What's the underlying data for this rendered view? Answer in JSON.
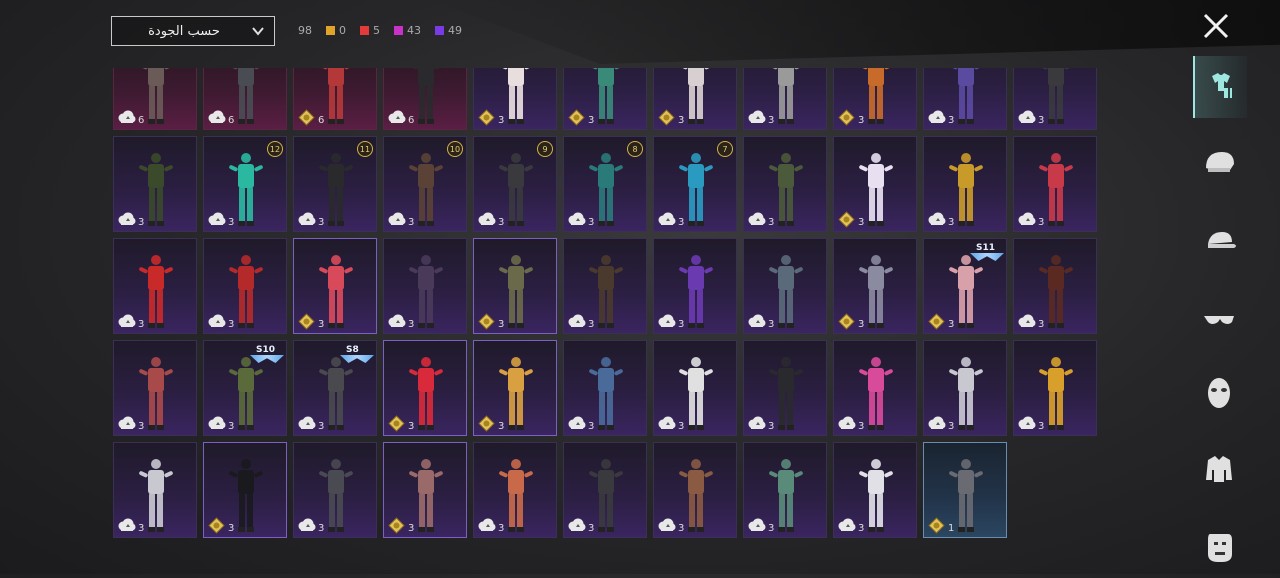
{
  "sort_dropdown": {
    "label": "حسب الجودة"
  },
  "counts": {
    "total": "98",
    "by_quality": [
      {
        "color": "#e0a42a",
        "value": "0"
      },
      {
        "color": "#e43a3a",
        "value": "5"
      },
      {
        "color": "#c832c8",
        "value": "43"
      },
      {
        "color": "#7a3ae6",
        "value": "49"
      }
    ]
  },
  "close_icon": "close-icon",
  "sidebar": [
    {
      "icon": "outfit-icon",
      "active": true
    },
    {
      "icon": "helmet-icon"
    },
    {
      "icon": "cap-icon"
    },
    {
      "icon": "glasses-icon"
    },
    {
      "icon": "mask-icon"
    },
    {
      "icon": "jacket-icon"
    },
    {
      "icon": "face-icon"
    }
  ],
  "items": [
    {
      "count": "6",
      "badge": "cloud",
      "quality": "red",
      "color": "#6a5a58"
    },
    {
      "count": "6",
      "badge": "cloud",
      "quality": "red",
      "color": "#4a4c54"
    },
    {
      "count": "6",
      "badge": "gold",
      "quality": "red",
      "color": "#b43838"
    },
    {
      "count": "6",
      "badge": "cloud",
      "quality": "red",
      "color": "#2a2a2e"
    },
    {
      "count": "3",
      "badge": "gold",
      "quality": "purple",
      "color": "#e8dede"
    },
    {
      "count": "3",
      "badge": "gold",
      "quality": "purple",
      "color": "#3a8a7a"
    },
    {
      "count": "3",
      "badge": "gold",
      "quality": "purple",
      "color": "#d8d0d0"
    },
    {
      "count": "3",
      "badge": "cloud",
      "quality": "purple",
      "color": "#9a9a9a"
    },
    {
      "count": "3",
      "badge": "gold",
      "quality": "purple",
      "color": "#c86a2a"
    },
    {
      "count": "3",
      "badge": "cloud",
      "quality": "purple",
      "color": "#5a4aa0"
    },
    {
      "count": "3",
      "badge": "cloud",
      "quality": "purple",
      "color": "#3a3a3e"
    },
    {
      "count": "3",
      "badge": "cloud",
      "quality": "purple",
      "color": "#3a4a2a"
    },
    {
      "count": "3",
      "badge": "cloud",
      "quality": "purple",
      "color": "#2ab8a0",
      "level": "12"
    },
    {
      "count": "3",
      "badge": "cloud",
      "quality": "purple",
      "color": "#2a2a2c",
      "level": "11"
    },
    {
      "count": "3",
      "badge": "cloud",
      "quality": "purple",
      "color": "#5a4236",
      "level": "10"
    },
    {
      "count": "3",
      "badge": "cloud",
      "quality": "purple",
      "color": "#3a3a3e",
      "level": "9"
    },
    {
      "count": "3",
      "badge": "cloud",
      "quality": "purple",
      "color": "#2a7a7a",
      "level": "8"
    },
    {
      "count": "3",
      "badge": "cloud",
      "quality": "purple",
      "color": "#2a9ac0",
      "level": "7"
    },
    {
      "count": "3",
      "badge": "cloud",
      "quality": "purple",
      "color": "#4a5a3a"
    },
    {
      "count": "3",
      "badge": "gold",
      "quality": "purple",
      "color": "#e8e0f0"
    },
    {
      "count": "3",
      "badge": "cloud",
      "quality": "purple",
      "color": "#c89a2a"
    },
    {
      "count": "3",
      "badge": "cloud",
      "quality": "purple",
      "color": "#c83a4a"
    },
    {
      "count": "3",
      "badge": "cloud",
      "quality": "purple",
      "color": "#c82a2a"
    },
    {
      "count": "3",
      "badge": "cloud",
      "quality": "purple",
      "color": "#b42a2a"
    },
    {
      "count": "3",
      "badge": "gold",
      "quality": "purple",
      "color": "#d84a5a",
      "highlight": true
    },
    {
      "count": "3",
      "badge": "cloud",
      "quality": "purple",
      "color": "#4a3a5a"
    },
    {
      "count": "3",
      "badge": "gold",
      "quality": "purple",
      "color": "#6a6a4a",
      "highlight": true
    },
    {
      "count": "3",
      "badge": "cloud",
      "quality": "purple",
      "color": "#4a3a2e"
    },
    {
      "count": "3",
      "badge": "cloud",
      "quality": "purple",
      "color": "#6a3ab0"
    },
    {
      "count": "3",
      "badge": "cloud",
      "quality": "purple",
      "color": "#5a6a7a"
    },
    {
      "count": "3",
      "badge": "gold",
      "quality": "purple",
      "color": "#8a8aa0"
    },
    {
      "count": "3",
      "badge": "gold",
      "quality": "purple",
      "color": "#d8a0a8",
      "season": "S11"
    },
    {
      "count": "3",
      "badge": "cloud",
      "quality": "purple",
      "color": "#5a2a22"
    },
    {
      "count": "3",
      "badge": "cloud",
      "quality": "purple",
      "color": "#a84a4a"
    },
    {
      "count": "3",
      "badge": "cloud",
      "quality": "purple",
      "color": "#5a6a3a",
      "season": "S10"
    },
    {
      "count": "3",
      "badge": "cloud",
      "quality": "purple",
      "color": "#4a4a4e",
      "season": "S8"
    },
    {
      "count": "3",
      "badge": "gold",
      "quality": "purple",
      "color": "#d82a3a",
      "highlight": true
    },
    {
      "count": "3",
      "badge": "gold",
      "quality": "purple",
      "color": "#d8a040",
      "highlight": true
    },
    {
      "count": "3",
      "badge": "cloud",
      "quality": "purple",
      "color": "#4a6a9a"
    },
    {
      "count": "3",
      "badge": "cloud",
      "quality": "purple",
      "color": "#e0e0e0"
    },
    {
      "count": "3",
      "badge": "cloud",
      "quality": "purple",
      "color": "#2a2a2e"
    },
    {
      "count": "3",
      "badge": "cloud",
      "quality": "purple",
      "color": "#d84a9a"
    },
    {
      "count": "3",
      "badge": "cloud",
      "quality": "purple",
      "color": "#c8c8d0"
    },
    {
      "count": "3",
      "badge": "cloud",
      "quality": "purple",
      "color": "#d8a02a"
    },
    {
      "count": "3",
      "badge": "cloud",
      "quality": "purple",
      "color": "#c8c8d0"
    },
    {
      "count": "3",
      "badge": "gold",
      "quality": "purple",
      "color": "#1a1a1e",
      "highlight": true
    },
    {
      "count": "3",
      "badge": "cloud",
      "quality": "purple",
      "color": "#4a4a52"
    },
    {
      "count": "3",
      "badge": "gold",
      "quality": "purple",
      "color": "#9a6a6a",
      "highlight": true
    },
    {
      "count": "3",
      "badge": "cloud",
      "quality": "purple",
      "color": "#c86a4a"
    },
    {
      "count": "3",
      "badge": "cloud",
      "quality": "purple",
      "color": "#3a3a3e"
    },
    {
      "count": "3",
      "badge": "cloud",
      "quality": "purple",
      "color": "#8a5a42"
    },
    {
      "count": "3",
      "badge": "cloud",
      "quality": "purple",
      "color": "#5a8a7a"
    },
    {
      "count": "3",
      "badge": "cloud",
      "quality": "purple",
      "color": "#e0e0e6"
    },
    {
      "count": "1",
      "badge": "gold",
      "quality": "blue",
      "color": "#6a6a72"
    }
  ]
}
